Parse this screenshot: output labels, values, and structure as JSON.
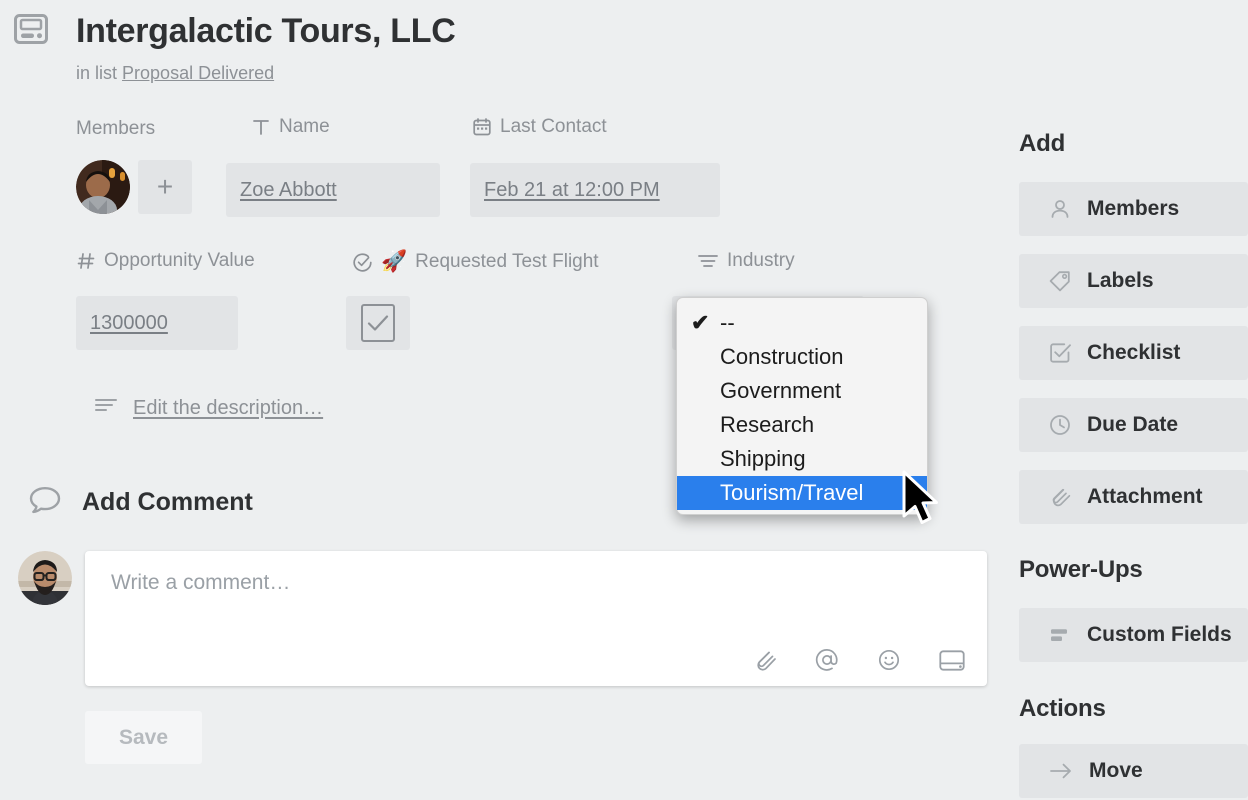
{
  "card": {
    "icon": "card-icon",
    "title": "Intergalactic Tours, LLC",
    "in_list_prefix": "in list",
    "list_name": "Proposal Delivered"
  },
  "custom_fields": [
    {
      "key": "members",
      "label": "Members",
      "icon": "none",
      "value": ""
    },
    {
      "key": "name",
      "label": "Name",
      "icon": "text-icon",
      "value": "Zoe Abbott"
    },
    {
      "key": "last_contact",
      "label": "Last Contact",
      "icon": "calendar-icon",
      "value": "Feb 21 at 12:00 PM"
    },
    {
      "key": "opportunity_value",
      "label": "Opportunity Value",
      "icon": "number-icon",
      "value": "1300000"
    },
    {
      "key": "requested_test_flight",
      "label": "Requested Test Flight",
      "icon": "checkbox-circle-icon",
      "emoji": "🚀",
      "value": "checked"
    },
    {
      "key": "industry",
      "label": "Industry",
      "icon": "list-icon",
      "value": ""
    }
  ],
  "add_member": {
    "label": "+"
  },
  "description": {
    "icon": "description-icon",
    "link_text": "Edit the description…"
  },
  "comment": {
    "icon": "comment-icon",
    "heading": "Add Comment",
    "placeholder": "Write a comment…",
    "value": "",
    "toolbar": [
      {
        "name": "attachment-icon",
        "glyph": "paperclip"
      },
      {
        "name": "mention-icon",
        "glyph": "at"
      },
      {
        "name": "emoji-icon",
        "glyph": "smiley"
      },
      {
        "name": "card-insert-icon",
        "glyph": "card"
      }
    ],
    "save_label": "Save"
  },
  "industry_dropdown": {
    "selected": "--",
    "highlighted": "Tourism/Travel",
    "check_glyph": "✔",
    "highlight_color": "#2a7fec",
    "options": [
      {
        "label": "--",
        "checked": true,
        "highlighted": false
      },
      {
        "label": "Construction",
        "checked": false,
        "highlighted": false
      },
      {
        "label": "Government",
        "checked": false,
        "highlighted": false
      },
      {
        "label": "Research",
        "checked": false,
        "highlighted": false
      },
      {
        "label": "Shipping",
        "checked": false,
        "highlighted": false
      },
      {
        "label": "Tourism/Travel",
        "checked": false,
        "highlighted": true
      }
    ]
  },
  "sidebar": {
    "sections": [
      {
        "heading": "Add",
        "items": [
          {
            "label": "Members",
            "icon": "person-icon"
          },
          {
            "label": "Labels",
            "icon": "tag-icon"
          },
          {
            "label": "Checklist",
            "icon": "checkbox-icon"
          },
          {
            "label": "Due Date",
            "icon": "clock-icon"
          },
          {
            "label": "Attachment",
            "icon": "paperclip-icon"
          }
        ]
      },
      {
        "heading": "Power-Ups",
        "items": [
          {
            "label": "Custom Fields",
            "icon": "fields-icon"
          }
        ]
      },
      {
        "heading": "Actions",
        "items": [
          {
            "label": "Move",
            "icon": "arrow-right-icon"
          }
        ]
      }
    ]
  },
  "colors": {
    "page_background": "#edeff0",
    "field_background": "#e2e4e6",
    "text_primary": "#2f3133",
    "text_muted": "#8d9196",
    "accent_highlight": "#2a7fec"
  }
}
